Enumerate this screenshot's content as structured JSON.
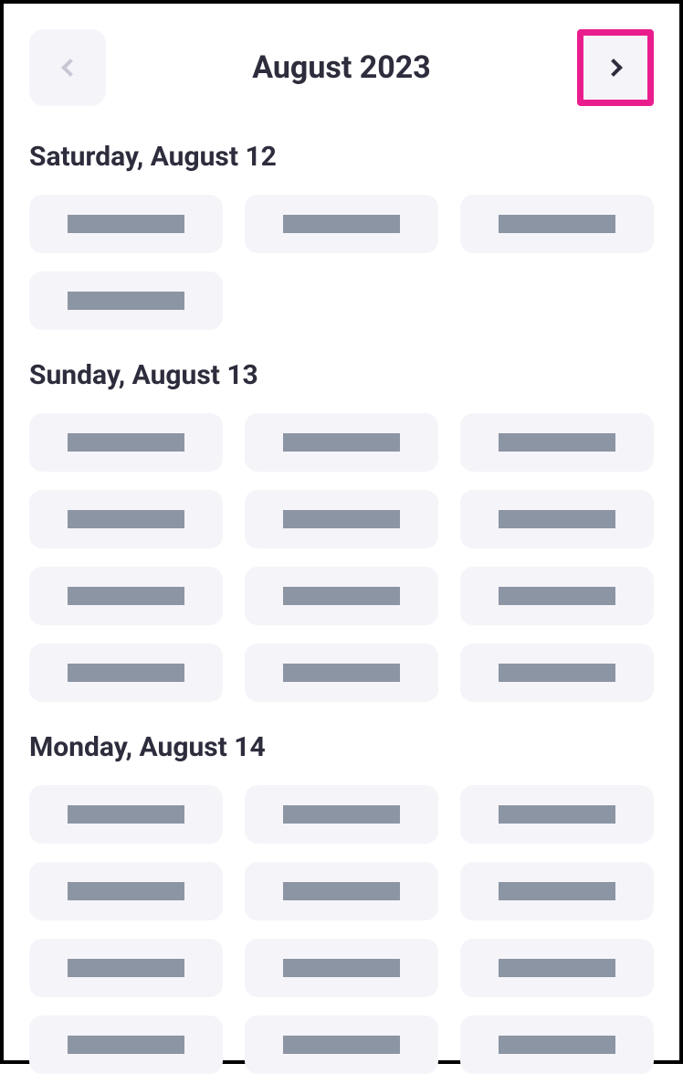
{
  "header": {
    "month_title": "August 2023",
    "prev_enabled": false,
    "next_highlighted": true
  },
  "days": [
    {
      "heading": "Saturday, August 12",
      "slot_count": 4
    },
    {
      "heading": "Sunday, August 13",
      "slot_count": 12
    },
    {
      "heading": "Monday, August 14",
      "slot_count": 12
    }
  ]
}
